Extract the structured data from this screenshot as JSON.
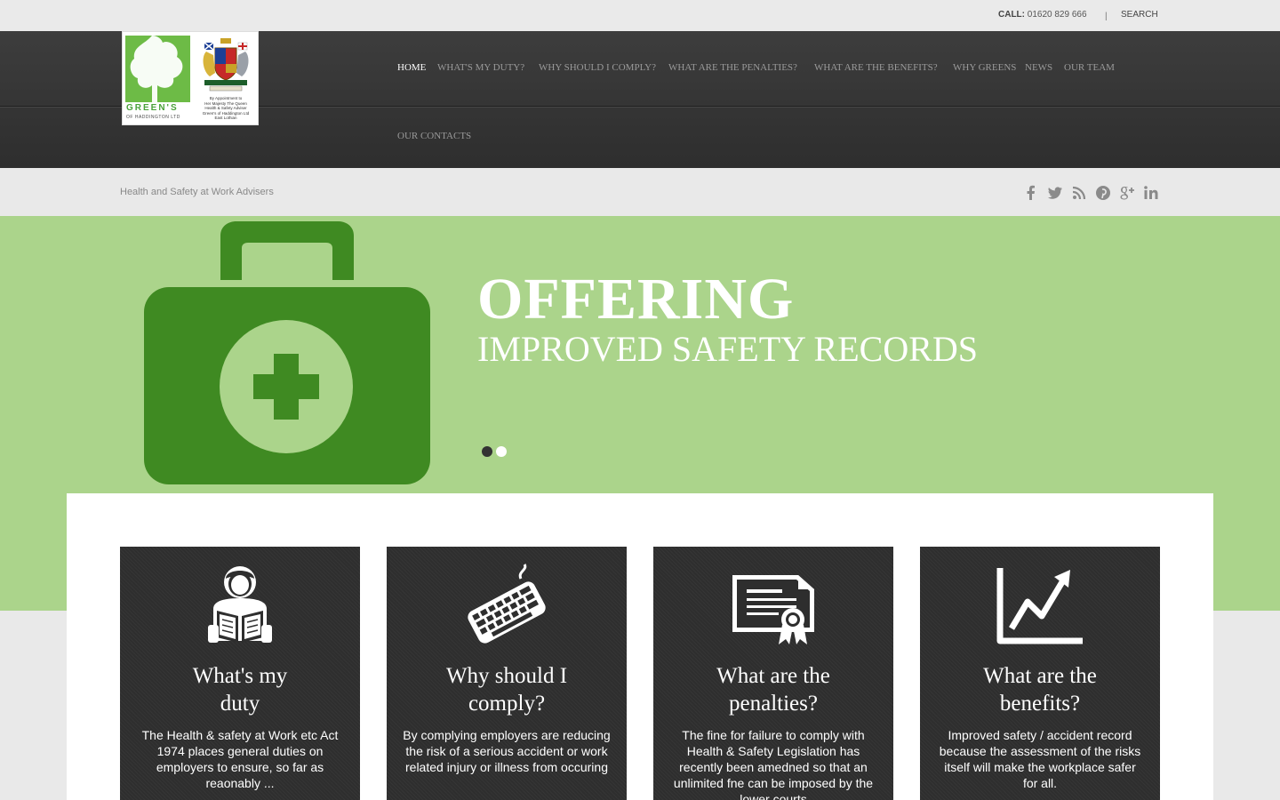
{
  "topbar": {
    "call_label": "CALL:",
    "phone": "01620 829 666",
    "separator": "|",
    "search_label": "SEARCH"
  },
  "logo": {
    "brand": "GREEN'S",
    "brand_sub": "OF HADDINGTON LTD",
    "warrant_lines": [
      "By Appointment to",
      "Her Majesty The Queen",
      "Health & Safety Adviser",
      "Green's of Haddington Ltd",
      "East Lothian"
    ]
  },
  "nav": {
    "items": [
      {
        "label": "HOME"
      },
      {
        "label": "WHAT'S MY DUTY?"
      },
      {
        "label": "WHY SHOULD I COMPLY?"
      },
      {
        "label": "WHAT ARE THE PENALTIES?"
      },
      {
        "label": "WHAT ARE THE BENEFITS?"
      },
      {
        "label": "WHY GREENS"
      },
      {
        "label": "NEWS"
      },
      {
        "label": "OUR TEAM"
      },
      {
        "label": "OUR CONTACTS"
      }
    ]
  },
  "subbar": {
    "tagline": "Health and Safety at Work Advisers",
    "social": [
      "facebook-icon",
      "twitter-icon",
      "rss-icon",
      "pinterest-icon",
      "google-plus-icon",
      "linkedin-icon"
    ]
  },
  "hero": {
    "headline": "OFFERING",
    "subline": "IMPROVED SAFETY RECORDS",
    "icon": "first-aid-kit-icon",
    "slides_count": 2,
    "active_slide": 1
  },
  "cards": [
    {
      "icon": "person-reading-icon",
      "title_line1": "What's my",
      "title_line2": "duty",
      "text": "The Health & safety at Work etc Act 1974 places general duties on employers to ensure, so far as reaonably ..."
    },
    {
      "icon": "keyboard-icon",
      "title_line1": "Why should I",
      "title_line2": "comply?",
      "text": "By complying employers are reducing the risk of a serious accident or work related injury or illness from occuring"
    },
    {
      "icon": "certificate-icon",
      "title_line1": "What are the",
      "title_line2": "penalties?",
      "text": "The fine for failure to comply with Health & Safety Legislation has recently been amedned so that an unlimited fne can be imposed by the lower courts"
    },
    {
      "icon": "growth-chart-icon",
      "title_line1": "What are the",
      "title_line2": "benefits?",
      "text": "Improved safety / accident record because the assessment of the risks itself will make the workplace safer for all."
    }
  ],
  "colors": {
    "hero_green": "#abd48b",
    "kit_green": "#3f8a22",
    "header_dark": "#333333",
    "card_dark": "#2e2e2e"
  }
}
